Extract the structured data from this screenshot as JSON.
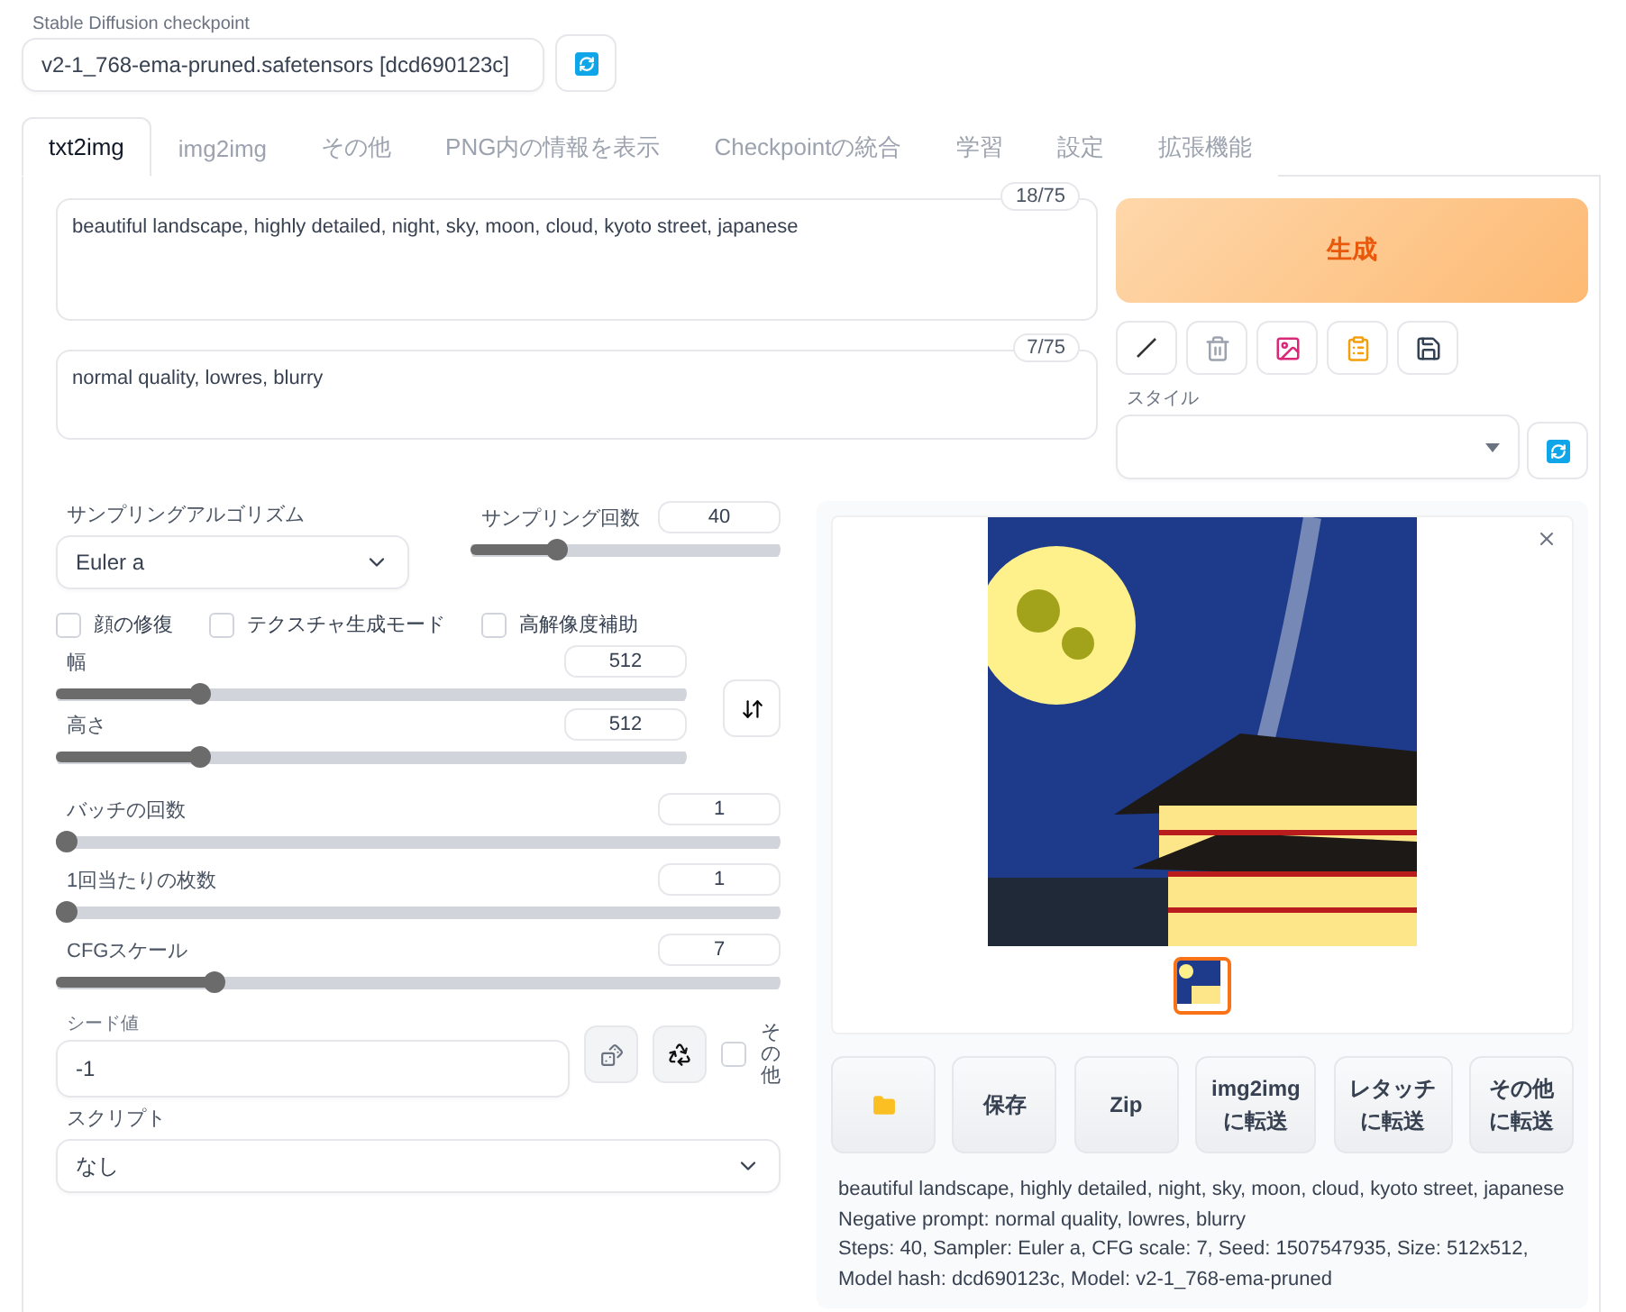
{
  "checkpoint": {
    "label": "Stable Diffusion checkpoint",
    "value": "v2-1_768-ema-pruned.safetensors [dcd690123c]"
  },
  "tabs": [
    {
      "label": "txt2img",
      "selected": true
    },
    {
      "label": "img2img",
      "selected": false
    },
    {
      "label": "その他",
      "selected": false
    },
    {
      "label": "PNG内の情報を表示",
      "selected": false
    },
    {
      "label": "Checkpointの統合",
      "selected": false
    },
    {
      "label": "学習",
      "selected": false
    },
    {
      "label": "設定",
      "selected": false
    },
    {
      "label": "拡張機能",
      "selected": false
    }
  ],
  "prompt": {
    "value": "beautiful landscape, highly detailed, night,  sky,  moon, cloud, kyoto street, japanese",
    "token_count": "18/75"
  },
  "negative_prompt": {
    "value": "normal quality,  lowres, blurry",
    "token_count": "7/75"
  },
  "generate_button": "生成",
  "tool_buttons": [
    {
      "kind": "pencil"
    },
    {
      "kind": "trash"
    },
    {
      "kind": "picture"
    },
    {
      "kind": "clipboard"
    },
    {
      "kind": "floppy"
    }
  ],
  "styles": {
    "label": "スタイル"
  },
  "sampler": {
    "label": "サンプリングアルゴリズム",
    "value": "Euler a"
  },
  "sampling_steps": {
    "label": "サンプリング回数",
    "value": "40",
    "level": 0.26
  },
  "checkboxes": [
    {
      "label": "顔の修復",
      "checked": false
    },
    {
      "label": "テクスチャ生成モード",
      "checked": false
    },
    {
      "label": "高解像度補助",
      "checked": false
    }
  ],
  "size_sliders": [
    {
      "label": "幅",
      "value": "512",
      "level": 0.22
    },
    {
      "label": "高さ",
      "value": "512",
      "level": 0.22
    }
  ],
  "sliders": [
    {
      "label": "バッチの回数",
      "value": "1",
      "level": 0
    },
    {
      "label": "1回当たりの枚数",
      "value": "1",
      "level": 0
    },
    {
      "label": "CFGスケール",
      "value": "7",
      "level": 0.21
    }
  ],
  "seed": {
    "label": "シード値",
    "value": "-1",
    "extra_label": "その他",
    "extra_checked": false
  },
  "script": {
    "label": "スクリプト",
    "value": "なし"
  },
  "gallery": {
    "thumbnail_selected": true
  },
  "output_buttons": [
    {
      "kind": "folder"
    },
    {
      "kind": "text",
      "lines": [
        "保存"
      ]
    },
    {
      "kind": "text",
      "lines": [
        "Zip"
      ]
    },
    {
      "kind": "text",
      "lines": [
        "img2img",
        "に転送"
      ]
    },
    {
      "kind": "text",
      "lines": [
        "レタッチ",
        "に転送"
      ]
    },
    {
      "kind": "text",
      "lines": [
        "その他",
        "に転送"
      ]
    }
  ],
  "info": [
    "beautiful landscape, highly detailed, night, sky, moon, cloud, kyoto street, japanese",
    "Negative prompt: normal quality, lowres, blurry",
    "Steps: 40, Sampler: Euler a, CFG scale: 7, Seed: 1507547935, Size: 512x512, Model hash: dcd690123c, Model: v2-1_768-ema-pruned"
  ]
}
